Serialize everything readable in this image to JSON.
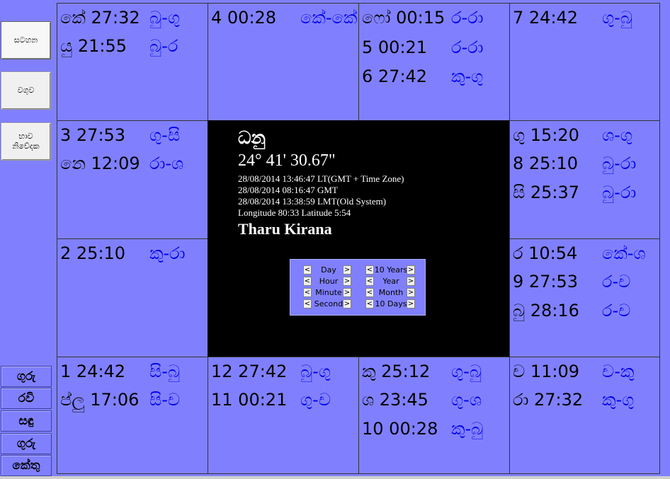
{
  "sidebar": {
    "buttons": [
      {
        "label": "සටහන"
      },
      {
        "label": "වගුව"
      },
      {
        "label": "භාව නිවේදක"
      }
    ],
    "planets": [
      "ගුරු",
      "රවි",
      "සඳු",
      "ගුරු",
      "කේතු"
    ]
  },
  "houses": {
    "h1": [
      {
        "a": "කේ  27:32",
        "b": "බු-ගු"
      },
      {
        "a": "යු  21:55",
        "b": "බු-ර"
      }
    ],
    "h2": [
      {
        "a": "4  00:28",
        "b": "කේ-කේ"
      }
    ],
    "h3": [
      {
        "a": "ෆෝ  00:15",
        "b": "ර-රා"
      },
      {
        "a": "5  00:21",
        "b": "ර-රා"
      },
      {
        "a": "6  27:42",
        "b": "කු-ගු"
      }
    ],
    "h4": [
      {
        "a": "7  24:42",
        "b": "ගු-බු"
      }
    ],
    "h5": [
      {
        "a": "3  27:53",
        "b": "ගු-සි"
      },
      {
        "a": "නෙ  12:09",
        "b": "රා-ශ"
      }
    ],
    "h6": [
      {
        "a": "ගු  15:20",
        "b": "ශ-ගු"
      },
      {
        "a": "8  25:10",
        "b": "බු-රා"
      },
      {
        "a": "සි  25:37",
        "b": "බු-රා"
      }
    ],
    "h7": [
      {
        "a": "2  25:10",
        "b": "කු-රා"
      }
    ],
    "h8": [
      {
        "a": "ර  10:54",
        "b": "කේ-ශ"
      },
      {
        "a": "9  27:53",
        "b": "ර-ච"
      },
      {
        "a": "බු  28:16",
        "b": "ර-ච"
      }
    ],
    "h9": [
      {
        "a": "1  24:42",
        "b": "සි-බු"
      },
      {
        "a": "ප්ලු  17:06",
        "b": "සි-ච"
      }
    ],
    "h10": [
      {
        "a": "12  27:42",
        "b": "බු-ගු"
      },
      {
        "a": "11  00:21",
        "b": "ගු-ච"
      }
    ],
    "h11": [
      {
        "a": "කු  25:12",
        "b": "ගු-බු"
      },
      {
        "a": "ශ  23:45",
        "b": "ගු-ශ"
      },
      {
        "a": "10  00:28",
        "b": "කු-බු"
      }
    ],
    "h12": [
      {
        "a": "ච  11:09",
        "b": "ච-කු"
      },
      {
        "a": "රා  27:32",
        "b": "කු-ගු"
      }
    ]
  },
  "center": {
    "sign": "ධනු",
    "degree": "24° 41' 30.67\"",
    "lt": "28/08/2014 13:46:47 LT(GMT + Time Zone)",
    "gmt": "28/08/2014 08:16:47 GMT",
    "lmt": "28/08/2014 13:38:59 LMT(Old System)",
    "coords": "Longitude 80:33  Latitude 5:54",
    "brand": "Tharu Kirana"
  },
  "controls": {
    "left": [
      "Day",
      "Hour",
      "Minute",
      "Second"
    ],
    "right": [
      "10 Years",
      "Year",
      "Month",
      "10 Days"
    ],
    "prev_glyph": "<",
    "next_glyph": ">"
  }
}
